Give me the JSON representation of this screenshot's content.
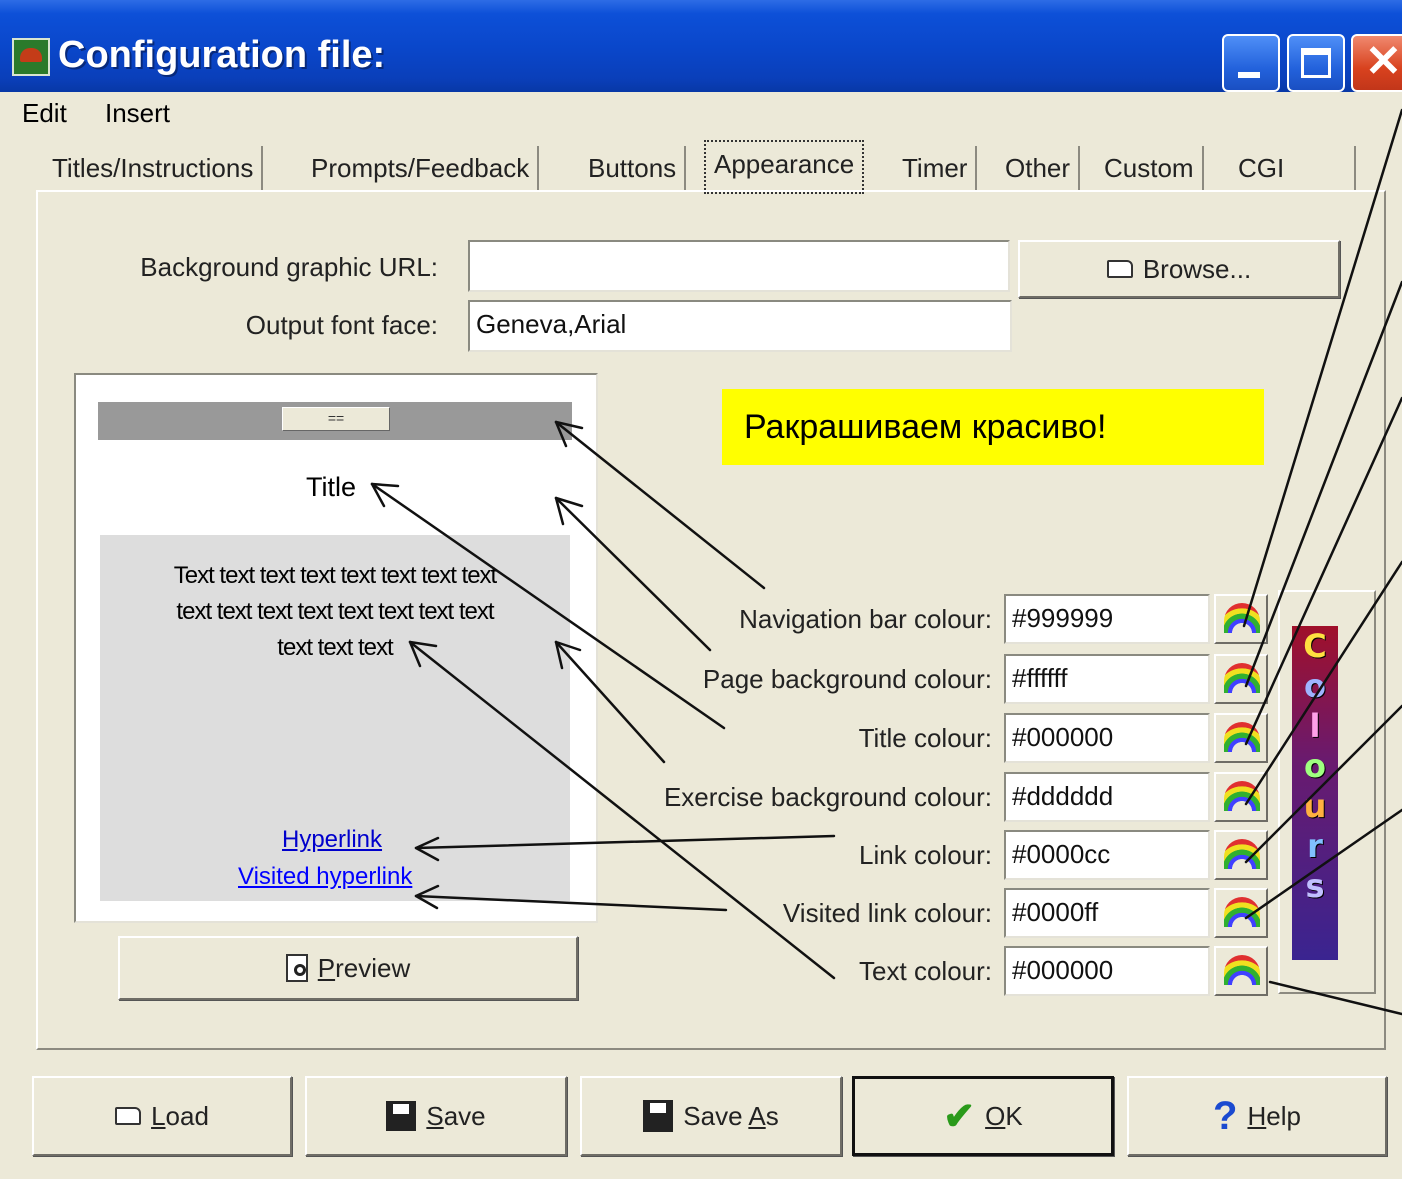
{
  "window": {
    "title": "Configuration file:",
    "close_glyph": "✕"
  },
  "menu": [
    "Edit",
    "Insert"
  ],
  "tabs": [
    {
      "label": "Titles/Instructions"
    },
    {
      "label": "Prompts/Feedback"
    },
    {
      "label": "Buttons"
    },
    {
      "label": "Appearance",
      "active": true
    },
    {
      "label": "Timer"
    },
    {
      "label": "Other"
    },
    {
      "label": "Custom"
    },
    {
      "label": "CGI"
    }
  ],
  "appearance": {
    "background_graphic_label": "Background graphic URL:",
    "background_graphic_value": "",
    "browse_label": "Browse...",
    "font_face_label": "Output font face:",
    "font_face_value": "Geneva,Arial"
  },
  "preview": {
    "nav_button": "==",
    "title": "Title",
    "body_text": "Text text text text text text text text\ntext text text text text text text text\ntext text text",
    "hyperlink": "Hyperlink",
    "visited_hyperlink": "Visited hyperlink",
    "preview_button_prefix": "",
    "preview_button_mnemonic": "P",
    "preview_button_rest": "review"
  },
  "note": "Ракрашиваем  красиво!",
  "colours": [
    {
      "label": "Navigation bar colour:",
      "value": "#999999"
    },
    {
      "label": "Page background colour:",
      "value": "#ffffff"
    },
    {
      "label": "Title colour:",
      "value": "#000000"
    },
    {
      "label": "Exercise background colour:",
      "value": "#dddddd"
    },
    {
      "label": "Link colour:",
      "value": "#0000cc"
    },
    {
      "label": "Visited link colour:",
      "value": "#0000ff"
    },
    {
      "label": "Text colour:",
      "value": "#000000"
    }
  ],
  "colours_logo": [
    "C",
    "o",
    "l",
    "o",
    "u",
    "r",
    "s"
  ],
  "footer_buttons": [
    {
      "mnemonic": "L",
      "rest": "oad",
      "icon": "folder-icon"
    },
    {
      "mnemonic": "S",
      "rest": "ave",
      "icon": "floppy-icon"
    },
    {
      "prefix": "Save ",
      "mnemonic": "A",
      "rest": "s",
      "icon": "floppy-edit-icon"
    },
    {
      "mnemonic": "O",
      "rest": "K",
      "icon": "checkmark-icon"
    },
    {
      "mnemonic": "H",
      "rest": "elp",
      "icon": "question-icon"
    }
  ],
  "palette": {
    "titlebar": "#0a46c9",
    "face": "#ece9d8",
    "note_bg": "#ffff00",
    "link": "#0000cc",
    "visited": "#0000ff"
  }
}
